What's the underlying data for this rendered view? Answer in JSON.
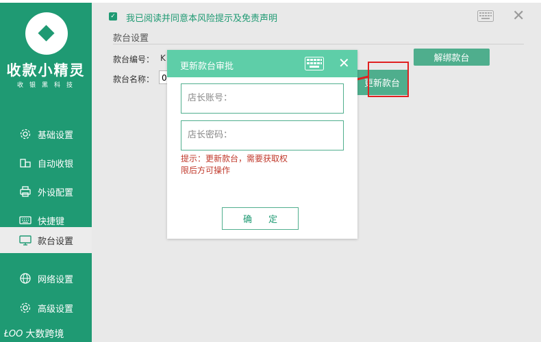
{
  "sidebar": {
    "brand": "收款小精灵",
    "brand_sub": "收银黑科技",
    "items": [
      {
        "label": "基础设置",
        "icon": "gear-icon"
      },
      {
        "label": "自动收银",
        "icon": "coins-icon"
      },
      {
        "label": "外设配置",
        "icon": "printer-icon"
      },
      {
        "label": "快捷键",
        "icon": "keyboard-icon"
      },
      {
        "label": "款台设置",
        "icon": "monitor-icon",
        "active": true
      },
      {
        "label": "网络设置",
        "icon": "globe-icon"
      },
      {
        "label": "高级设置",
        "icon": "gear-icon"
      }
    ],
    "watermark": "大数跨境",
    "watermark_logo": "ŁOO"
  },
  "main": {
    "agree_text": "我已阅读并同意本风险提示及免责声明",
    "close_label": "✕",
    "section_title": "款台设置",
    "fields": {
      "number_label": "款台编号：",
      "number_value": "K",
      "name_label": "款台名称：",
      "name_value": "0"
    },
    "unbind_button": "解绑款台",
    "update_button": "更新款台"
  },
  "modal": {
    "title": "更新款台审批",
    "close_label": "✕",
    "account_placeholder": "店长账号：",
    "password_placeholder": "店长密码：",
    "hint": "提示：更新款台，需要获取权限后方可操作",
    "confirm_label": "确定"
  },
  "colors": {
    "sidebar": "#1f9a73",
    "accent": "#5ecea8",
    "button": "#4fae8d",
    "annotation": "#e02020"
  }
}
